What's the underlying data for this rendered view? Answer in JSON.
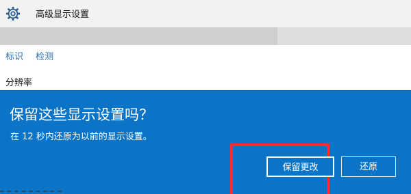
{
  "window": {
    "title": "高级显示设置",
    "icon": "gear-icon"
  },
  "settings": {
    "links": [
      "标识",
      "检测"
    ],
    "resolution_label": "分辨率"
  },
  "dialog": {
    "title": "保留这些显示设置吗？",
    "message": "在 12 秒内还原为以前的显示设置。",
    "keep_button": "保留更改",
    "revert_button": "还原"
  },
  "colors": {
    "dialog_bg": "#0b74c6",
    "highlight": "#ff2a2a",
    "link": "#2a6fb3"
  }
}
